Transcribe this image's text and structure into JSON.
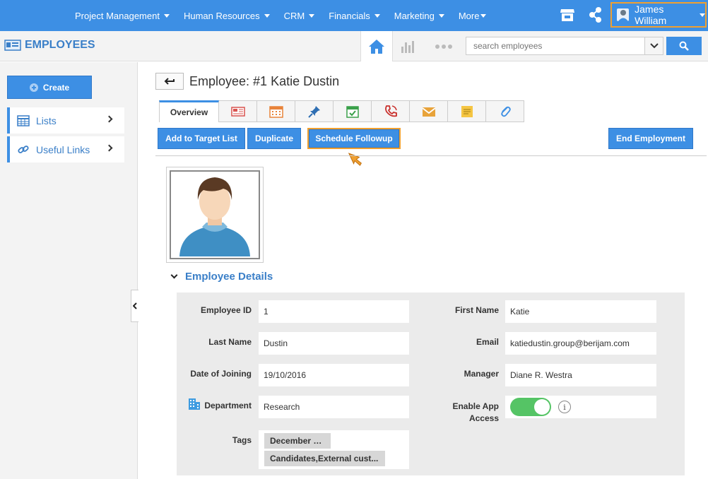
{
  "topnav": {
    "menu": [
      {
        "label": "Project Management"
      },
      {
        "label": "Human Resources"
      },
      {
        "label": "CRM"
      },
      {
        "label": "Financials"
      },
      {
        "label": "Marketing"
      },
      {
        "label": "More"
      }
    ],
    "user_name": "James William",
    "icons": [
      "store-icon",
      "share-icon",
      "user-avatar-icon"
    ]
  },
  "subbar": {
    "module_title": "EMPLOYEES",
    "search_placeholder": "search employees"
  },
  "sidebar": {
    "create_label": "Create",
    "items": [
      {
        "label": "Lists",
        "icon": "table-icon"
      },
      {
        "label": "Useful Links",
        "icon": "link-icon"
      }
    ]
  },
  "page": {
    "title": "Employee: #1 Katie Dustin",
    "tabs": [
      {
        "label": "Overview"
      },
      {
        "icon": "newspaper-icon"
      },
      {
        "icon": "calendar-icon"
      },
      {
        "icon": "pin-icon"
      },
      {
        "icon": "task-icon"
      },
      {
        "icon": "phone-icon"
      },
      {
        "icon": "email-icon"
      },
      {
        "icon": "note-icon"
      },
      {
        "icon": "attachment-icon"
      }
    ],
    "actions": {
      "add_to_target": "Add to Target List",
      "duplicate": "Duplicate",
      "schedule_followup": "Schedule Followup",
      "end_employment": "End Employment"
    },
    "section_title": "Employee Details",
    "fields": {
      "employee_id": {
        "label": "Employee ID",
        "value": "1"
      },
      "first_name": {
        "label": "First Name",
        "value": "Katie"
      },
      "last_name": {
        "label": "Last Name",
        "value": "Dustin"
      },
      "email": {
        "label": "Email",
        "value": "katiedustin.group@berijam.com"
      },
      "date_of_joining": {
        "label": "Date of Joining",
        "value": "19/10/2016"
      },
      "manager": {
        "label": "Manager",
        "value": "Diane R. Westra"
      },
      "department": {
        "label": "Department",
        "value": "Research"
      },
      "enable_app_access": {
        "label_line1": "Enable App",
        "label_line2": "Access",
        "enabled": true
      },
      "tags": {
        "label": "Tags",
        "values": [
          "December sale",
          "Candidates,External cust..."
        ]
      }
    }
  },
  "colors": {
    "primary": "#3d8fe4",
    "highlight": "#f0a030",
    "toggle_on": "#55c465"
  }
}
